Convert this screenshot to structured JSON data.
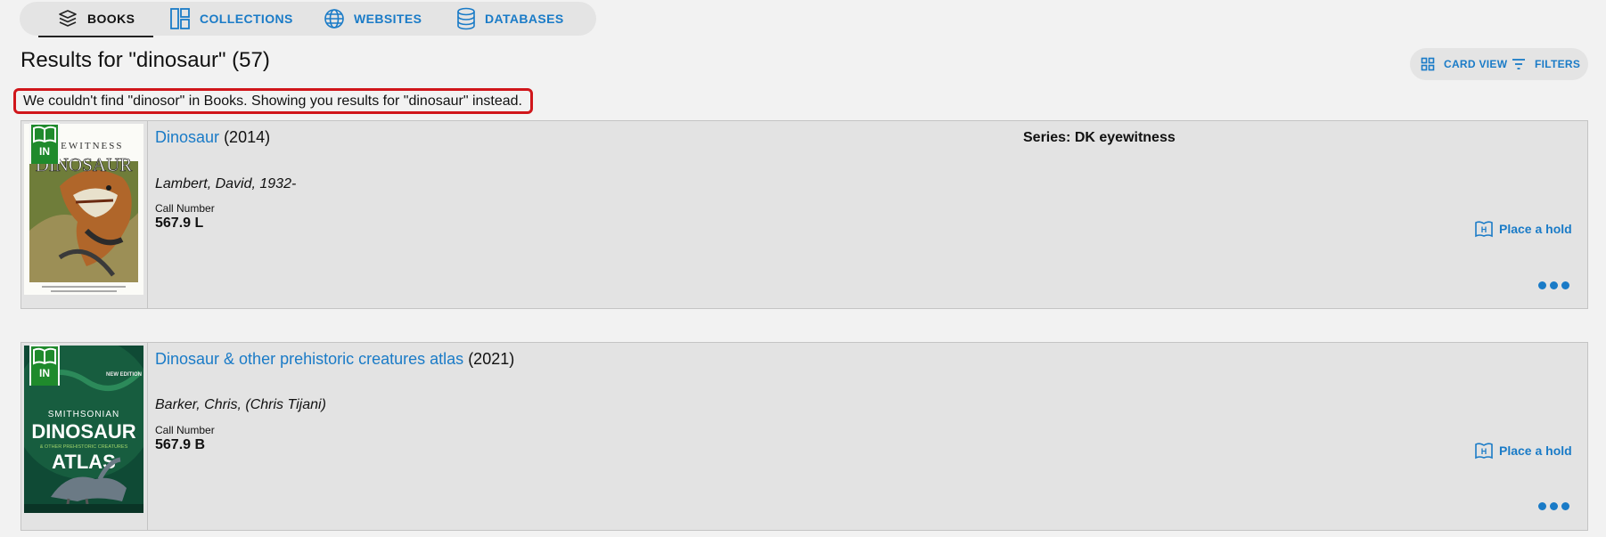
{
  "tabs": [
    {
      "label": "BOOKS",
      "icon": "books-stack-icon",
      "active": true
    },
    {
      "label": "COLLECTIONS",
      "icon": "collections-icon",
      "active": false
    },
    {
      "label": "WEBSITES",
      "icon": "globe-icon",
      "active": false
    },
    {
      "label": "DATABASES",
      "icon": "database-icon",
      "active": false
    }
  ],
  "results_title": "Results for \"dinosaur\" (57)",
  "view": {
    "card_view_label": "CARD VIEW",
    "filters_label": "FILTERS"
  },
  "notice": "We couldn't find \"dinosor\" in Books. Showing you results for \"dinosaur\" instead.",
  "results": [
    {
      "title": "Dinosaur",
      "year": "(2014)",
      "series": "Series: DK eyewitness",
      "author": "Lambert, David, 1932-",
      "call_number_label": "Call Number",
      "call_number": "567.9 L",
      "availability": "IN",
      "hold_label": "Place a hold",
      "cover": {
        "top_text": "EYEWITNESS",
        "main_text": "DINOSAUR"
      }
    },
    {
      "title": "Dinosaur & other prehistoric creatures atlas",
      "year": "(2021)",
      "author": "Barker, Chris, (Chris Tijani)",
      "call_number_label": "Call Number",
      "call_number": "567.9 B",
      "availability": "IN",
      "hold_label": "Place a hold",
      "cover": {
        "top_text": "NEW EDITION",
        "brand_text": "SMITHSONIAN",
        "main_text": "DINOSAUR",
        "sub_text": "& OTHER PREHISTORIC CREATURES",
        "atlas_text": "ATLAS"
      }
    }
  ],
  "colors": {
    "accent": "#1a7bc7",
    "available_badge": "#1f8a2c",
    "notice_border": "#d0161b"
  }
}
